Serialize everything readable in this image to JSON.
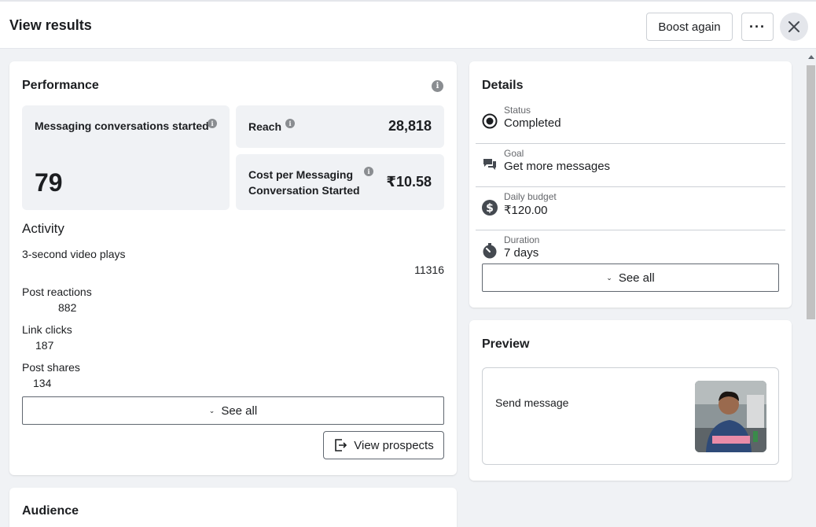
{
  "header": {
    "title": "View results",
    "boost_label": "Boost again",
    "more_label": "···"
  },
  "performance": {
    "title": "Performance",
    "messaging": {
      "label": "Messaging conversations started",
      "value": "79"
    },
    "reach": {
      "label": "Reach",
      "value": "28,818"
    },
    "cost": {
      "label_line1": "Cost per Messaging",
      "label_line2": "Conversation Started",
      "value": "₹10.58"
    },
    "activity_title": "Activity",
    "activity": [
      {
        "label": "3-second video plays",
        "value": "11316"
      },
      {
        "label": "Post reactions",
        "value": "882"
      },
      {
        "label": "Link clicks",
        "value": "187"
      },
      {
        "label": "Post shares",
        "value": "134"
      }
    ],
    "see_all_label": "See all",
    "view_prospects_label": "View prospects"
  },
  "details": {
    "title": "Details",
    "rows": [
      {
        "label": "Status",
        "value": "Completed",
        "icon": "radio-selected-icon"
      },
      {
        "label": "Goal",
        "value": "Get more messages",
        "icon": "chat-bubbles-icon"
      },
      {
        "label": "Daily budget",
        "value": "₹120.00",
        "icon": "dollar-circle-icon"
      },
      {
        "label": "Duration",
        "value": "7 days",
        "icon": "stopwatch-icon"
      }
    ],
    "see_all_label": "See all"
  },
  "preview": {
    "title": "Preview",
    "message_label": "Send message"
  },
  "audience": {
    "title": "Audience"
  },
  "colors": {
    "background": "#f0f2f5",
    "card": "#ffffff",
    "metric_box": "#f0f2f5",
    "text": "#1c1e21",
    "muted": "#65676b"
  }
}
